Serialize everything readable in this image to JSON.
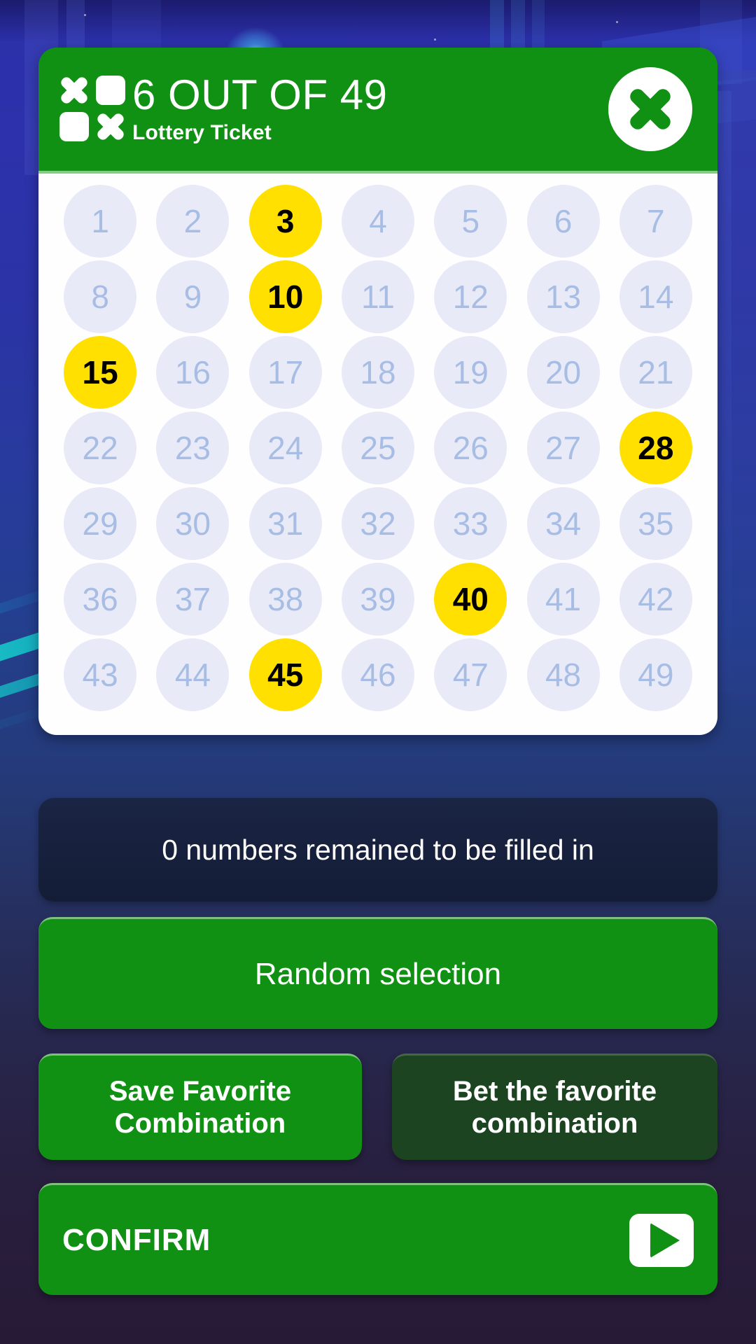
{
  "header": {
    "logo_icon": "lottery-grid-icon",
    "title": "6 OUT OF 49",
    "subtitle": "Lottery Ticket",
    "close_icon": "close-x-icon"
  },
  "grid": {
    "total_numbers": 49,
    "columns": 7,
    "numbers": [
      1,
      2,
      3,
      4,
      5,
      6,
      7,
      8,
      9,
      10,
      11,
      12,
      13,
      14,
      15,
      16,
      17,
      18,
      19,
      20,
      21,
      22,
      23,
      24,
      25,
      26,
      27,
      28,
      29,
      30,
      31,
      32,
      33,
      34,
      35,
      36,
      37,
      38,
      39,
      40,
      41,
      42,
      43,
      44,
      45,
      46,
      47,
      48,
      49
    ],
    "selected": [
      3,
      10,
      15,
      28,
      40,
      45
    ]
  },
  "status": {
    "message": "0 numbers remained to be filled in",
    "remaining": 0
  },
  "buttons": {
    "random": "Random selection",
    "save_favorite": "Save Favorite Combination",
    "bet_favorite": "Bet the favorite combination",
    "confirm": "CONFIRM",
    "confirm_icon": "play-icon"
  },
  "colors": {
    "brand_green": "#119113",
    "disabled_green": "#1d4420",
    "selected_ball": "#ffe000",
    "unselected_ball": "#e9eaf7",
    "unselected_text": "#a8bde4",
    "status_panel": "#141d36"
  }
}
